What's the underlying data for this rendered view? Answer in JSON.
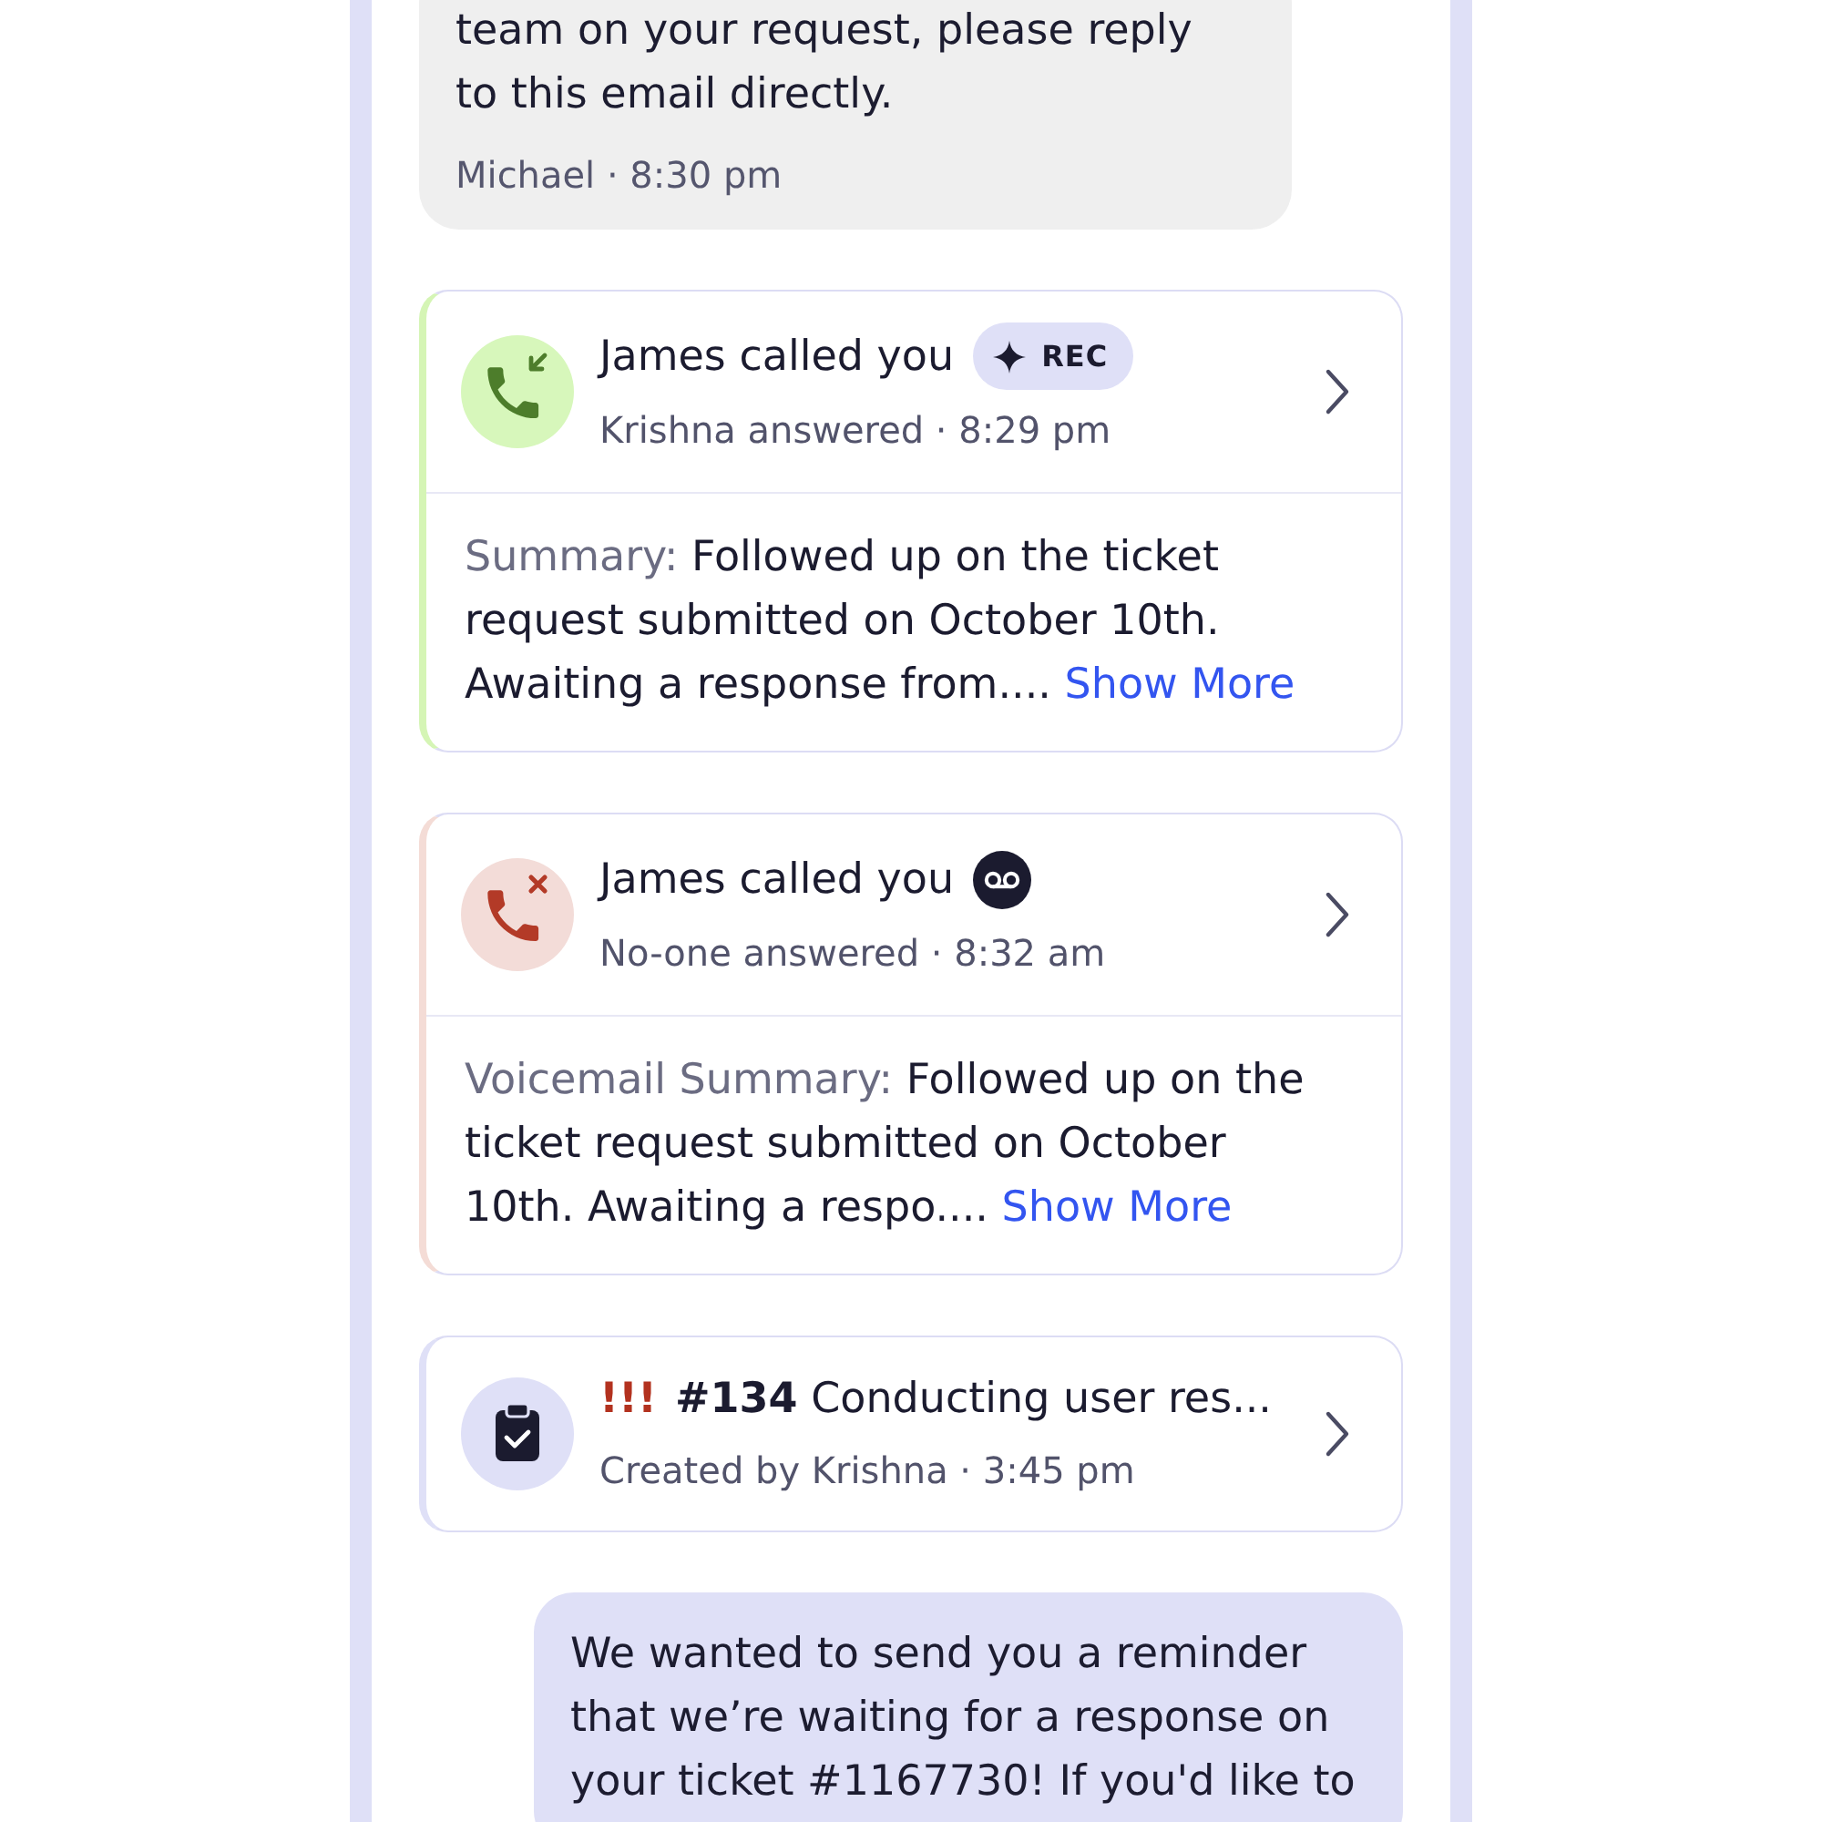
{
  "thread": [
    {
      "kind": "received",
      "text": "team on your request, please reply to this email directly.",
      "meta": "Michael · 8:30 pm"
    },
    {
      "kind": "answered",
      "title": "James called you",
      "badge": {
        "kind": "recording",
        "label": "REC"
      },
      "subtitle": "Krishna answered · 8:29 pm",
      "summary": {
        "label": "Summary:",
        "text": "Followed up on the ticket request submitted on October 10th. Awaiting a response from....",
        "link": "Show More"
      }
    },
    {
      "kind": "missed",
      "title": "James called you",
      "badge": {
        "kind": "voicemail"
      },
      "subtitle": "No-one answered · 8:32 am",
      "summary": {
        "label": "Voicemail Summary:",
        "text": "Followed up on the ticket request submitted on October 10th. Awaiting a respo....",
        "link": "Show More"
      }
    },
    {
      "kind": "task",
      "priority": "!!!",
      "title": "**#134** Conducting user res...",
      "subtitle": "Created by Krishna · 3:45 pm"
    },
    {
      "kind": "sent",
      "text": "We wanted to send you a reminder that we’re waiting for a response on your ticket #1167730! If you'd like to"
    }
  ]
}
